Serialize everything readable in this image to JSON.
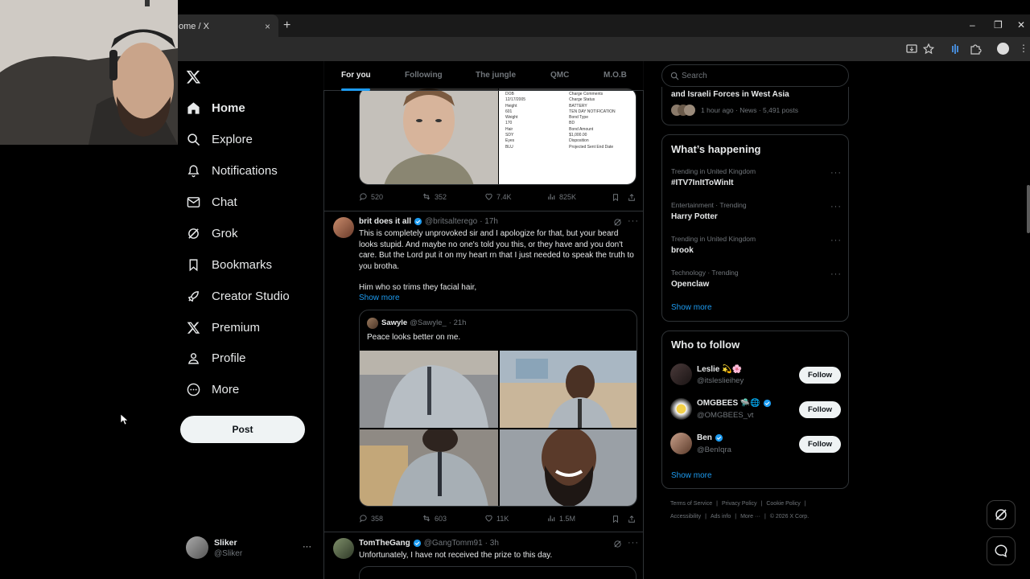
{
  "browser": {
    "tab_title": "ome / X",
    "tab_close": "×",
    "new_tab": "+"
  },
  "nav": {
    "items": [
      {
        "label": "Home",
        "icon": "home-icon"
      },
      {
        "label": "Explore",
        "icon": "search-icon"
      },
      {
        "label": "Notifications",
        "icon": "bell-icon"
      },
      {
        "label": "Chat",
        "icon": "mail-icon"
      },
      {
        "label": "Grok",
        "icon": "grok-icon"
      },
      {
        "label": "Bookmarks",
        "icon": "bookmark-icon"
      },
      {
        "label": "Creator Studio",
        "icon": "rocket-icon"
      },
      {
        "label": "Premium",
        "icon": "x-logo-icon"
      },
      {
        "label": "Profile",
        "icon": "person-icon"
      },
      {
        "label": "More",
        "icon": "more-circle-icon"
      }
    ],
    "post_label": "Post",
    "account": {
      "name": "Sliker",
      "handle": "@Sliker",
      "more": "···"
    }
  },
  "timeline": {
    "tabs": [
      "For you",
      "Following",
      "The jungle",
      "QMC",
      "M.O.B"
    ],
    "selected_tab": "For you",
    "mugshot_doc_lines": [
      "DOB",
      "12/17/2005",
      "Height",
      "601",
      "Weight",
      "170",
      "Hair",
      "SDY",
      "Eyes",
      "BLU",
      "BATTERY",
      "TEN DAY NOTIFICATION",
      "Bond Type",
      "BD",
      "Bond Amount",
      "$1,000.00",
      "Disposition",
      "Projected Sent End Date",
      "Charge Comments",
      "Charge Status"
    ],
    "post1_actions": {
      "replies": "520",
      "reposts": "352",
      "likes": "7.4K",
      "views": "825K"
    },
    "post2": {
      "name": "brit does it all",
      "handle": "@britsalterego",
      "time": "· 17h",
      "text": "This is completely unprovoked sir and I apologize for that, but your beard looks stupid. And maybe no one's told you this, or they have and you don't care. But the Lord put it on my heart rn that I just needed to speak the truth to you brotha.",
      "text2": "Him who so trims they facial hair,",
      "show_more": "Show more",
      "quote": {
        "name": "Sawyle",
        "handle": "@Sawyle_",
        "time": "· 21h",
        "text": "Peace looks better on me."
      },
      "actions": {
        "replies": "358",
        "reposts": "603",
        "likes": "11K",
        "views": "1.5M"
      }
    },
    "post3": {
      "name": "TomTheGang",
      "handle": "@GangTomm91",
      "time": "· 3h",
      "text": "Unfortunately, I have not received the prize to this day."
    }
  },
  "right": {
    "search_placeholder": "Search",
    "top_card": {
      "title": "and Israeli Forces in West Asia",
      "meta": "1 hour ago · News · 5,491 posts"
    },
    "happening": {
      "title": "What’s happening",
      "trends": [
        {
          "meta": "Trending in United Kingdom",
          "name": "#ITV7InItToWinIt"
        },
        {
          "meta": "Entertainment · Trending",
          "name": "Harry Potter"
        },
        {
          "meta": "Trending in United Kingdom",
          "name": "brook"
        },
        {
          "meta": "Technology · Trending",
          "name": "Openclaw"
        }
      ],
      "show_more": "Show more"
    },
    "who_to_follow": {
      "title": "Who to follow",
      "users": [
        {
          "name": "Leslie 💫🌸",
          "handle": "@itsleslieihey",
          "verified": false
        },
        {
          "name": "OMGBEES 🛸🌐",
          "handle": "@OMGBEES_vt",
          "verified": true
        },
        {
          "name": "Ben",
          "handle": "@BenIqra",
          "verified": true
        }
      ],
      "follow_label": "Follow",
      "show_more": "Show more"
    },
    "footer": {
      "line1": [
        "Terms of Service",
        "|",
        "Privacy Policy",
        "|",
        "Cookie Policy",
        "|"
      ],
      "line2": [
        "Accessibility",
        "|",
        "Ads info",
        "|",
        "More ···",
        "|",
        "© 2026 X Corp."
      ]
    }
  },
  "colors": {
    "accent": "#1d9bf0",
    "bg": "#000000",
    "border": "#2f3336",
    "muted": "#71767b"
  }
}
